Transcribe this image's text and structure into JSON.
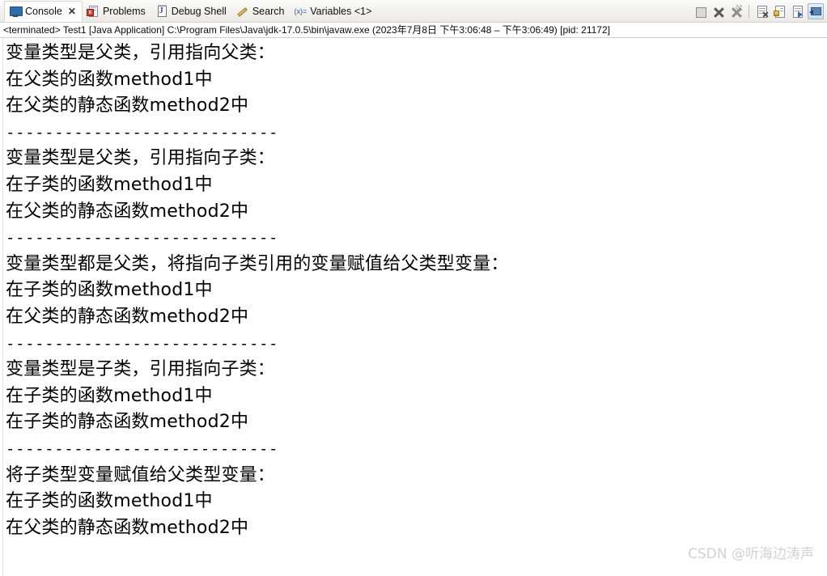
{
  "tabbar": {
    "tabs": [
      {
        "label": "Console",
        "icon": "console-monitor-icon",
        "active": true,
        "closable": true
      },
      {
        "label": "Problems",
        "icon": "problems-error-icon",
        "active": false,
        "closable": false
      },
      {
        "label": "Debug Shell",
        "icon": "debug-shell-icon",
        "active": false,
        "closable": false
      },
      {
        "label": "Search",
        "icon": "search-pencil-icon",
        "active": false,
        "closable": false
      },
      {
        "label": "Variables <1>",
        "icon": "variables-xequals-icon",
        "active": false,
        "closable": false
      }
    ],
    "close_glyph": "✕",
    "variables_icon_text": "(x)=",
    "toolbar_buttons": [
      {
        "name": "terminate-button",
        "icon": "stop-square-icon",
        "pressed": false
      },
      {
        "name": "remove-launch-button",
        "icon": "x-icon",
        "pressed": false
      },
      {
        "name": "remove-all-terminated-button",
        "icon": "x-all-icon",
        "pressed": false
      },
      {
        "name": "clear-console-button",
        "icon": "clear-console-icon",
        "pressed": false
      },
      {
        "name": "scroll-lock-button",
        "icon": "lock-icon",
        "pressed": false
      },
      {
        "name": "show-console-on-output-button",
        "icon": "page-arrow-icon",
        "pressed": false
      },
      {
        "name": "display-selected-console-button",
        "icon": "pin-console-icon",
        "pressed": true
      }
    ]
  },
  "launch": {
    "text": "<terminated> Test1 [Java Application] C:\\Program Files\\Java\\jdk-17.0.5\\bin\\javaw.exe  (2023年7月8日 下午3:06:48 – 下午3:06:49) [pid: 21172]"
  },
  "console": {
    "lines": [
      {
        "text": "变量类型是父类，引用指向父类：",
        "kind": "text"
      },
      {
        "text": "在父类的函数method1中",
        "kind": "text"
      },
      {
        "text": "在父类的静态函数method2中",
        "kind": "text"
      },
      {
        "text": "",
        "kind": "blank"
      },
      {
        "text": "----------------------------",
        "kind": "separator"
      },
      {
        "text": "变量类型是父类，引用指向子类：",
        "kind": "text"
      },
      {
        "text": "在子类的函数method1中",
        "kind": "text"
      },
      {
        "text": "在父类的静态函数method2中",
        "kind": "text"
      },
      {
        "text": "",
        "kind": "blank"
      },
      {
        "text": "----------------------------",
        "kind": "separator"
      },
      {
        "text": "变量类型都是父类，将指向子类引用的变量赋值给父类型变量：",
        "kind": "text"
      },
      {
        "text": "在子类的函数method1中",
        "kind": "text"
      },
      {
        "text": "在父类的静态函数method2中",
        "kind": "text"
      },
      {
        "text": "",
        "kind": "blank"
      },
      {
        "text": "----------------------------",
        "kind": "separator"
      },
      {
        "text": "变量类型是子类，引用指向子类：",
        "kind": "text"
      },
      {
        "text": "在子类的函数method1中",
        "kind": "text"
      },
      {
        "text": "在子类的静态函数method2中",
        "kind": "text"
      },
      {
        "text": "",
        "kind": "blank"
      },
      {
        "text": "----------------------------",
        "kind": "separator"
      },
      {
        "text": "将子类型变量赋值给父类型变量：",
        "kind": "text"
      },
      {
        "text": "在子类的函数method1中",
        "kind": "text"
      },
      {
        "text": "在父类的静态函数method2中",
        "kind": "text"
      }
    ]
  },
  "watermark": {
    "text": "CSDN @听海边涛声"
  },
  "colors": {
    "accent": "#2f6fae",
    "error": "#d33a2c",
    "text": "#000000",
    "chrome": "#f2f1ef",
    "border": "#d4d0c8",
    "watermark": "#d2d2d2"
  }
}
